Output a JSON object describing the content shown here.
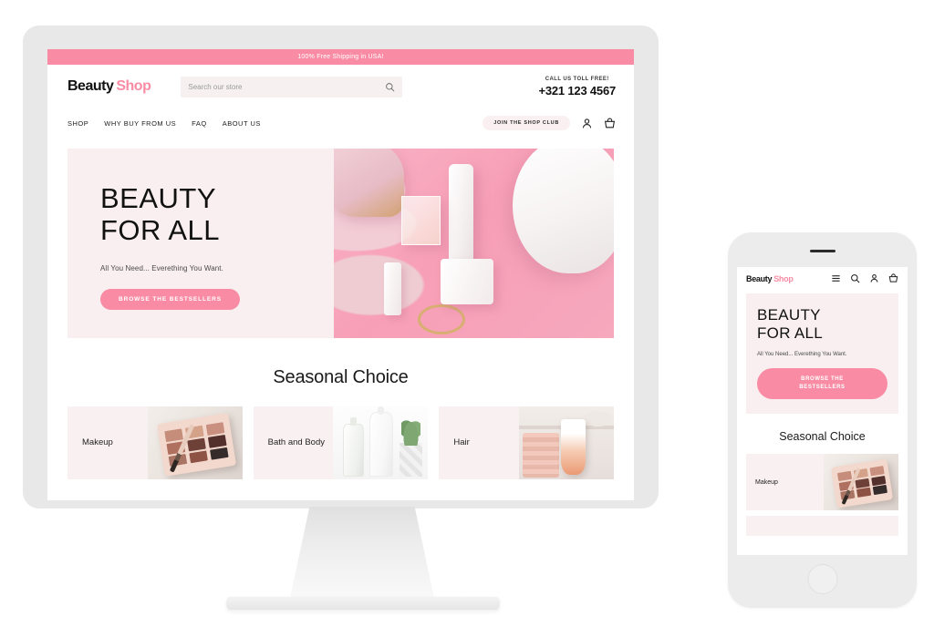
{
  "site": {
    "logo_primary": "Beauty",
    "logo_secondary": "Shop",
    "accent_pink": "#f98ca4",
    "soft_pink_bg": "#f9eff0",
    "card_bg": "#f9f0f1"
  },
  "announcement": {
    "text": "100% Free Shipping in USA!"
  },
  "search": {
    "placeholder": "Search our store",
    "value": "",
    "icon": "search-icon"
  },
  "contact": {
    "label": "CALL US TOLL FREE!",
    "number": "+321 123 4567"
  },
  "nav": {
    "items": [
      {
        "label": "SHOP"
      },
      {
        "label": "WHY BUY FROM US"
      },
      {
        "label": "FAQ"
      },
      {
        "label": "ABOUT US"
      }
    ],
    "club_button": "JOIN THE SHOP CLUB",
    "icons": [
      "user-icon",
      "basket-icon"
    ]
  },
  "hero": {
    "title_line1": "BEAUTY",
    "title_line2": "FOR ALL",
    "subtitle": "All You Need... Everething You Want.",
    "cta": "BROWSE THE BESTSELLERS",
    "cta_mobile_line1": "BROWSE THE",
    "cta_mobile_line2": "BESTSELLERS",
    "image_alt": "pink flat-lay of beauty products"
  },
  "seasonal": {
    "title": "Seasonal Choice",
    "cards": [
      {
        "label": "Makeup",
        "image_alt": "eyeshadow palette with brush"
      },
      {
        "label": "Bath and Body",
        "image_alt": "cocooil bottles and plant"
      },
      {
        "label": "Hair",
        "image_alt": "towels and honest hair tube"
      }
    ]
  },
  "mobile": {
    "icons": [
      "hamburger-icon",
      "search-icon",
      "user-icon",
      "basket-icon"
    ],
    "cards": [
      {
        "label": "Makeup",
        "image_alt": "eyeshadow palette with brush"
      }
    ]
  }
}
